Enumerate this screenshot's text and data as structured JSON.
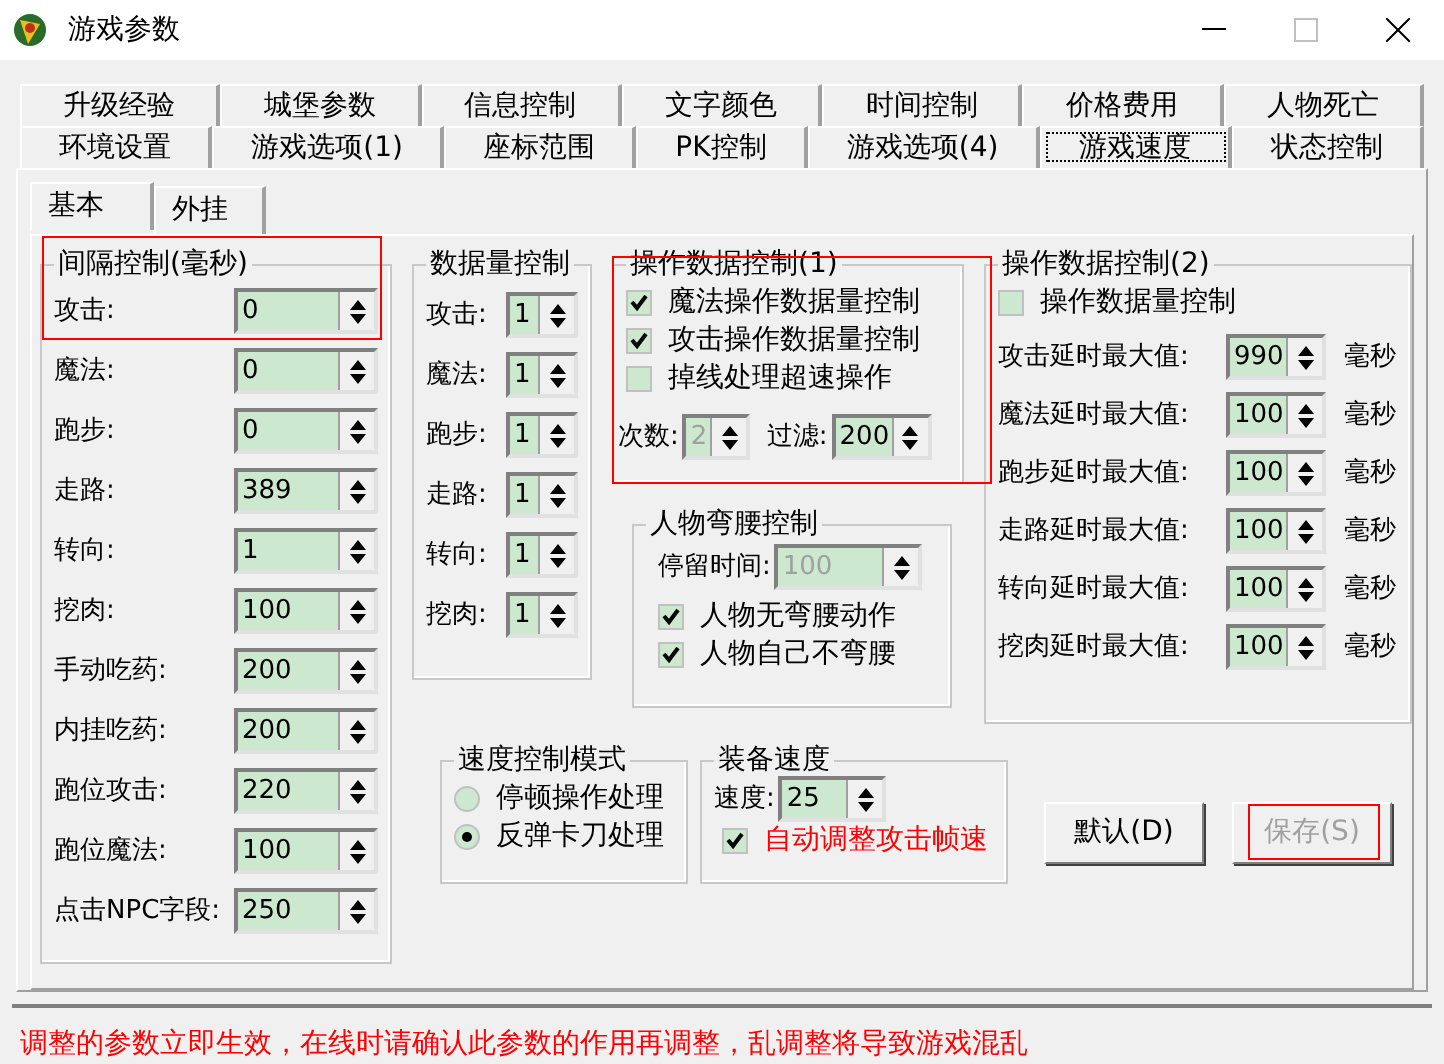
{
  "window": {
    "title": "游戏参数"
  },
  "tab_rows": [
    {
      "tabs": [
        {
          "label": "升级经验",
          "selected": false
        },
        {
          "label": "城堡参数",
          "selected": false
        },
        {
          "label": "信息控制",
          "selected": false
        },
        {
          "label": "文字颜色",
          "selected": false
        },
        {
          "label": "时间控制",
          "selected": false
        },
        {
          "label": "价格费用",
          "selected": false
        },
        {
          "label": "人物死亡",
          "selected": false
        }
      ]
    },
    {
      "tabs": [
        {
          "label": "环境设置",
          "selected": false
        },
        {
          "label": "游戏选项(1)",
          "selected": false
        },
        {
          "label": "座标范围",
          "selected": false
        },
        {
          "label": "PK控制",
          "selected": false
        },
        {
          "label": "游戏选项(4)",
          "selected": false
        },
        {
          "label": "游戏速度",
          "selected": true
        },
        {
          "label": "状态控制",
          "selected": false
        }
      ]
    }
  ],
  "subtabs": [
    {
      "label": "基本",
      "selected": true
    },
    {
      "label": "外挂",
      "selected": false
    }
  ],
  "interval_group": {
    "title": "间隔控制(毫秒)",
    "fields": [
      {
        "label": "攻击:",
        "value": "0",
        "highlighted": true
      },
      {
        "label": "魔法:",
        "value": "0",
        "highlighted": false
      },
      {
        "label": "跑步:",
        "value": "0",
        "highlighted": false
      },
      {
        "label": "走路:",
        "value": "389",
        "highlighted": false
      },
      {
        "label": "转向:",
        "value": "1",
        "highlighted": false
      },
      {
        "label": "挖肉:",
        "value": "100",
        "highlighted": false
      },
      {
        "label": "手动吃药:",
        "value": "200",
        "highlighted": false
      },
      {
        "label": "内挂吃药:",
        "value": "200",
        "highlighted": false
      },
      {
        "label": "跑位攻击:",
        "value": "220",
        "highlighted": false
      },
      {
        "label": "跑位魔法:",
        "value": "100",
        "highlighted": false
      },
      {
        "label": "点击NPC字段:",
        "value": "250",
        "highlighted": false
      }
    ]
  },
  "count_group": {
    "title": "数据量控制",
    "fields": [
      {
        "label": "攻击:",
        "value": "1"
      },
      {
        "label": "魔法:",
        "value": "1"
      },
      {
        "label": "跑步:",
        "value": "1"
      },
      {
        "label": "走路:",
        "value": "1"
      },
      {
        "label": "转向:",
        "value": "1"
      },
      {
        "label": "挖肉:",
        "value": "1"
      }
    ]
  },
  "operation_group_1": {
    "title": "操作数据控制(1)",
    "highlighted": true,
    "options": [
      {
        "label": "魔法操作数据量控制",
        "checked": true
      },
      {
        "label": "攻击操作数据量控制",
        "checked": true
      },
      {
        "label": "掉线处理超速操作",
        "checked": false
      }
    ],
    "times": {
      "label": "次数:",
      "value": "2",
      "disabled": true
    },
    "filter": {
      "label": "过滤:",
      "value": "200",
      "disabled": false
    }
  },
  "bend_group": {
    "title": "人物弯腰控制",
    "stay": {
      "label": "停留时间:",
      "value": "100",
      "disabled": true
    },
    "options": [
      {
        "label": "人物无弯腰动作",
        "checked": true
      },
      {
        "label": "人物自己不弯腰",
        "checked": true
      }
    ]
  },
  "operation_group_2": {
    "title": "操作数据控制(2)",
    "option": {
      "label": "操作数据量控制",
      "checked": false
    },
    "fields": [
      {
        "label": "攻击延时最大值:",
        "value": "990",
        "unit": "毫秒"
      },
      {
        "label": "魔法延时最大值:",
        "value": "100",
        "unit": "毫秒"
      },
      {
        "label": "跑步延时最大值:",
        "value": "100",
        "unit": "毫秒"
      },
      {
        "label": "走路延时最大值:",
        "value": "100",
        "unit": "毫秒"
      },
      {
        "label": "转向延时最大值:",
        "value": "100",
        "unit": "毫秒"
      },
      {
        "label": "挖肉延时最大值:",
        "value": "100",
        "unit": "毫秒"
      }
    ]
  },
  "speed_mode_group": {
    "title": "速度控制模式",
    "options": [
      {
        "label": "停顿操作处理",
        "selected": false
      },
      {
        "label": "反弹卡刀处理",
        "selected": true
      }
    ]
  },
  "equip_speed_group": {
    "title": "装备速度",
    "speed": {
      "label": "速度:",
      "value": "25"
    },
    "option": {
      "label": "自动调整攻击帧速",
      "checked": true
    }
  },
  "buttons": [
    {
      "label": "默认(D)",
      "disabled": false,
      "highlighted": false
    },
    {
      "label": "保存(S)",
      "disabled": true,
      "highlighted": true
    }
  ],
  "status_message": "调整的参数立即生效，在线时请确认此参数的作用再调整，乱调整将导致游戏混乱"
}
